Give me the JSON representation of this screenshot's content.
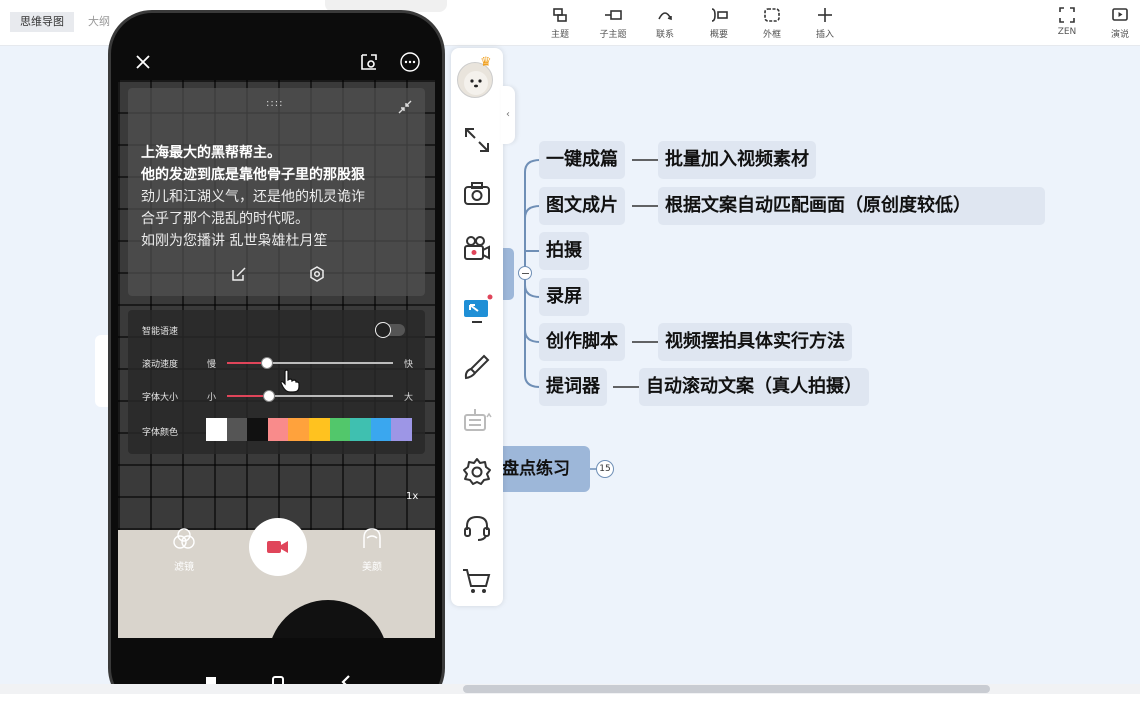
{
  "tabs": [
    {
      "label": "思维导图",
      "active": true
    },
    {
      "label": "大纲",
      "active": false
    }
  ],
  "tools": {
    "topic": "主题",
    "subtopic": "子主题",
    "relation": "联系",
    "summary": "概要",
    "boundary": "外框",
    "insert": "插入",
    "zen": "ZEN",
    "present": "演说"
  },
  "mindmap": {
    "nodes": [
      {
        "label": "一键成篇",
        "child": "批量加入视频素材"
      },
      {
        "label": "图文成片",
        "child": "根据文案自动匹配画面（原创度较低）"
      },
      {
        "label": "拍摄",
        "child": ""
      },
      {
        "label": "录屏",
        "child": ""
      },
      {
        "label": "创作脚本",
        "child": "视频摆拍具体实行方法"
      },
      {
        "label": "提词器",
        "child": "自动滚动文案（真人拍摄）"
      }
    ],
    "sibling": {
      "label": "盘点练习",
      "badge": "15"
    }
  },
  "panel": {
    "collapse_arrow": "‹",
    "crown": "♛"
  },
  "prompter": {
    "handle": "::::",
    "lines": [
      "上海最大的黑帮帮主。",
      "他的发迹到底是靠他骨子里的那股狠",
      "劲儿和江湖义气，还是他的机灵诡诈",
      "合乎了那个混乱的时代呢。",
      "如刚为您播讲  乱世枭雄杜月笙"
    ]
  },
  "settings": {
    "smart_speed": "智能语速",
    "scroll_speed": {
      "label": "滚动速度",
      "min": "慢",
      "max": "快",
      "value": 0.24
    },
    "font_size": {
      "label": "字体大小",
      "min": "小",
      "max": "大",
      "value": 0.25
    },
    "font_color": {
      "label": "字体颜色"
    },
    "swatches": [
      "#ffffff",
      "#555555",
      "#111111",
      "#f98b8b",
      "#ffa23c",
      "#ffc21f",
      "#52c76b",
      "#3fc0b0",
      "#3aa7ef",
      "#9d96e6"
    ]
  },
  "camera": {
    "zoom": "1x",
    "filter": "滤镜",
    "beauty": "美颜"
  },
  "colors": {
    "accent_red": "#e0455a",
    "node_fill": "#dfe6f1",
    "root_fill": "#9db7d9"
  }
}
